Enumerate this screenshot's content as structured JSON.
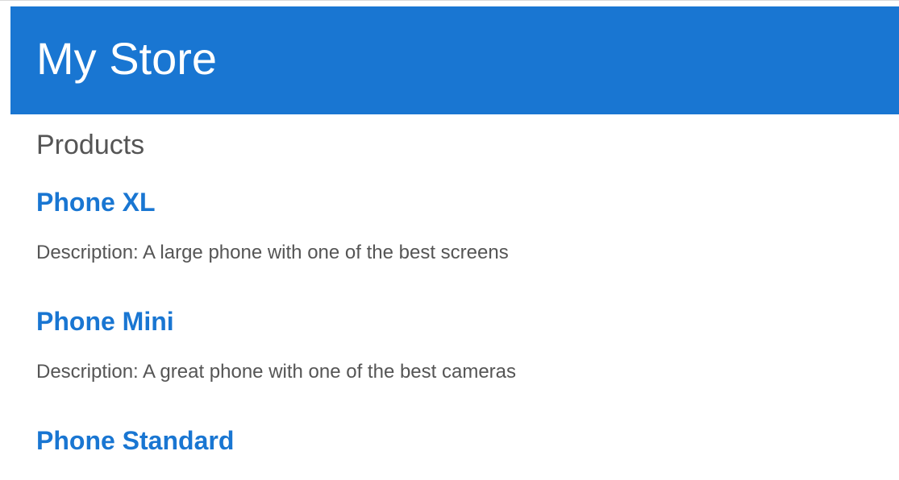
{
  "header": {
    "title": "My Store"
  },
  "main": {
    "section_title": "Products",
    "products": [
      {
        "name": "Phone XL",
        "description": "Description: A large phone with one of the best screens"
      },
      {
        "name": "Phone Mini",
        "description": "Description: A great phone with one of the best cameras"
      },
      {
        "name": "Phone Standard",
        "description": ""
      }
    ]
  },
  "colors": {
    "brand": "#1976d2",
    "text": "#555555",
    "background": "#ffffff"
  }
}
